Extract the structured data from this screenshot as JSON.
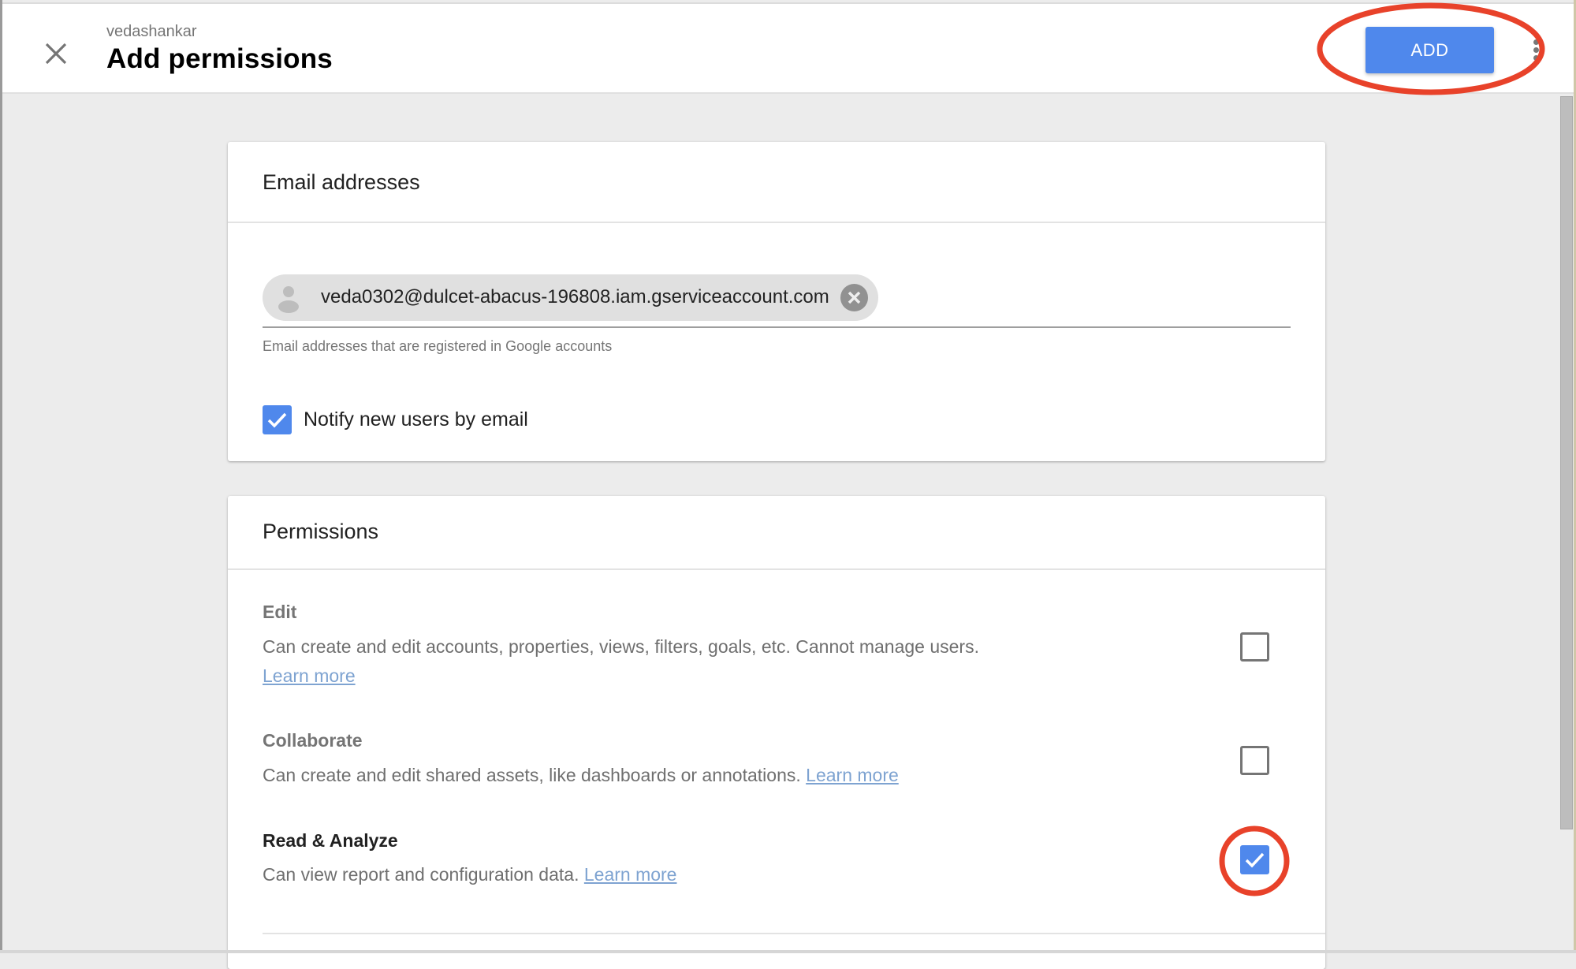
{
  "header": {
    "account_name": "vedashankar",
    "title": "Add permissions",
    "close_icon": "close-icon",
    "add_label": "ADD",
    "more_icon": "more-vert-icon"
  },
  "email_section": {
    "heading": "Email addresses",
    "chips": [
      {
        "avatar_icon": "person-icon",
        "email": "veda0302@dulcet-abacus-196808.iam.gserviceaccount.com",
        "remove_icon": "cancel-icon"
      }
    ],
    "helper_text": "Email addresses that are registered in Google accounts",
    "notify": {
      "label": "Notify new users by email",
      "checked": true
    }
  },
  "permissions_section": {
    "heading": "Permissions",
    "items": [
      {
        "title": "Edit",
        "description": "Can create and edit accounts, properties, views, filters, goals, etc. Cannot manage users.",
        "link": "Learn more",
        "checked": false
      },
      {
        "title": "Collaborate",
        "description": "Can create and edit shared assets, like dashboards or annotations.",
        "link": "Learn more",
        "checked": false
      },
      {
        "title": "Read & Analyze",
        "description": "Can view report and configuration data.",
        "link": "Learn more",
        "checked": true
      }
    ]
  },
  "annotations": {
    "highlight_color": "#e8422a",
    "highlighted": [
      "add-button",
      "read-analyze-checkbox"
    ]
  },
  "colors": {
    "primary": "#4f88ec",
    "background": "#ececec",
    "link": "#7ea3d1"
  }
}
